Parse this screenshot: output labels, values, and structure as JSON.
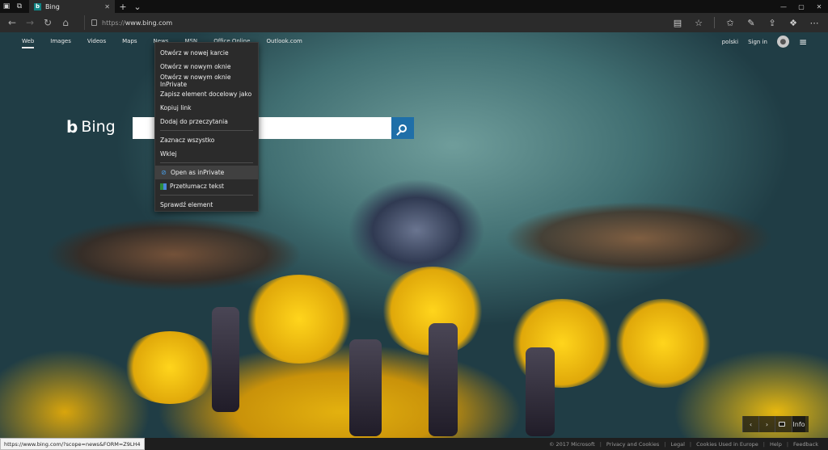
{
  "browser": {
    "tab_title": "Bing",
    "tab_close": "✕",
    "new_tab": "+",
    "tab_menu": "⌄",
    "url_protocol": "https://",
    "url_host": "www.bing.com",
    "window_controls": [
      "—",
      "▢",
      "✕"
    ]
  },
  "bing": {
    "scopes": [
      "Web",
      "Images",
      "Videos",
      "Maps",
      "News",
      "MSN",
      "Office Online",
      "Outlook.com"
    ],
    "active_scope": "Web",
    "language": "polski",
    "sign_in": "Sign in",
    "logo_text": "Bing",
    "logo_mark": "b",
    "search_value": "",
    "info_label": "Info",
    "prev_arrow": "‹",
    "next_arrow": "›"
  },
  "context_menu": {
    "items": [
      {
        "label": "Otwórz w nowej karcie"
      },
      {
        "label": "Otwórz w nowym oknie"
      },
      {
        "label": "Otwórz w nowym oknie InPrivate"
      },
      {
        "label": "Zapisz element docelowy jako"
      },
      {
        "label": "Kopiuj link"
      },
      {
        "label": "Dodaj do przeczytania"
      },
      {
        "label": "Zaznacz wszystko"
      },
      {
        "label": "Wklej"
      },
      {
        "label": "Open as inPrivate"
      },
      {
        "label": "Przetłumacz tekst"
      },
      {
        "label": "Sprawdź element"
      }
    ]
  },
  "footer": {
    "links": [
      "© 2017 Microsoft",
      "Privacy and Cookies",
      "Legal",
      "Cookies Used in Europe",
      "Help",
      "Feedback"
    ]
  },
  "status_bar": {
    "url": "https://www.bing.com/?scope=news&FORM=Z9LH4"
  },
  "colors": {
    "search_button": "#1f6fa8",
    "menu_background": "#2b2b2b",
    "tab_favicon": "#118585"
  }
}
